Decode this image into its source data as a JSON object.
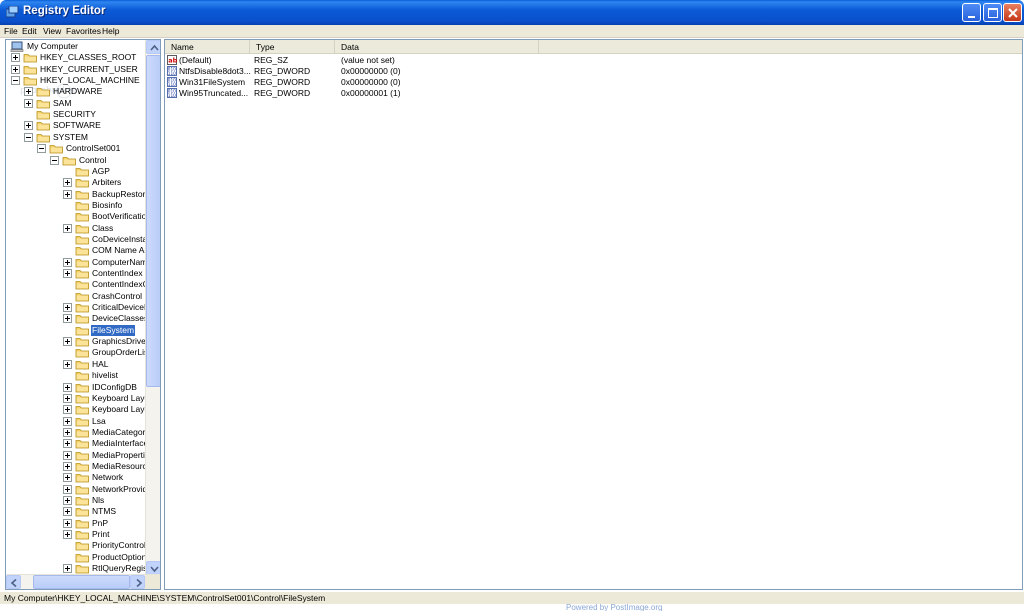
{
  "window": {
    "title": "Registry Editor"
  },
  "menu": [
    "File",
    "Edit",
    "View",
    "Favorites",
    "Help"
  ],
  "tree": [
    {
      "label": "My Computer",
      "indent": 0,
      "expander": "none",
      "icon": "computer"
    },
    {
      "label": "HKEY_CLASSES_ROOT",
      "indent": 1,
      "expander": "plus",
      "icon": "folder"
    },
    {
      "label": "HKEY_CURRENT_USER",
      "indent": 1,
      "expander": "plus",
      "icon": "folder"
    },
    {
      "label": "HKEY_LOCAL_MACHINE",
      "indent": 1,
      "expander": "minus",
      "icon": "folder"
    },
    {
      "label": "HARDWARE",
      "indent": 2,
      "expander": "plus",
      "icon": "folder"
    },
    {
      "label": "SAM",
      "indent": 2,
      "expander": "plus",
      "icon": "folder"
    },
    {
      "label": "SECURITY",
      "indent": 2,
      "expander": "none",
      "icon": "folder"
    },
    {
      "label": "SOFTWARE",
      "indent": 2,
      "expander": "plus",
      "icon": "folder"
    },
    {
      "label": "SYSTEM",
      "indent": 2,
      "expander": "minus",
      "icon": "folder"
    },
    {
      "label": "ControlSet001",
      "indent": 3,
      "expander": "minus",
      "icon": "folder"
    },
    {
      "label": "Control",
      "indent": 4,
      "expander": "minus",
      "icon": "folder-open"
    },
    {
      "label": "AGP",
      "indent": 5,
      "expander": "none",
      "icon": "folder"
    },
    {
      "label": "Arbiters",
      "indent": 5,
      "expander": "plus",
      "icon": "folder"
    },
    {
      "label": "BackupRestore",
      "indent": 5,
      "expander": "plus",
      "icon": "folder"
    },
    {
      "label": "Biosinfo",
      "indent": 5,
      "expander": "none",
      "icon": "folder"
    },
    {
      "label": "BootVerificationI",
      "indent": 5,
      "expander": "none",
      "icon": "folder"
    },
    {
      "label": "Class",
      "indent": 5,
      "expander": "plus",
      "icon": "folder"
    },
    {
      "label": "CoDeviceInstalle",
      "indent": 5,
      "expander": "none",
      "icon": "folder"
    },
    {
      "label": "COM Name Arbi",
      "indent": 5,
      "expander": "none",
      "icon": "folder"
    },
    {
      "label": "ComputerName",
      "indent": 5,
      "expander": "plus",
      "icon": "folder"
    },
    {
      "label": "ContentIndex",
      "indent": 5,
      "expander": "plus",
      "icon": "folder"
    },
    {
      "label": "ContentIndexCo",
      "indent": 5,
      "expander": "none",
      "icon": "folder"
    },
    {
      "label": "CrashControl",
      "indent": 5,
      "expander": "none",
      "icon": "folder"
    },
    {
      "label": "CriticalDeviceDa",
      "indent": 5,
      "expander": "plus",
      "icon": "folder"
    },
    {
      "label": "DeviceClasses",
      "indent": 5,
      "expander": "plus",
      "icon": "folder"
    },
    {
      "label": "FileSystem",
      "indent": 5,
      "expander": "none",
      "icon": "folder-open",
      "selected": true
    },
    {
      "label": "GraphicsDrivers",
      "indent": 5,
      "expander": "plus",
      "icon": "folder"
    },
    {
      "label": "GroupOrderList",
      "indent": 5,
      "expander": "none",
      "icon": "folder"
    },
    {
      "label": "HAL",
      "indent": 5,
      "expander": "plus",
      "icon": "folder"
    },
    {
      "label": "hivelist",
      "indent": 5,
      "expander": "none",
      "icon": "folder"
    },
    {
      "label": "IDConfigDB",
      "indent": 5,
      "expander": "plus",
      "icon": "folder"
    },
    {
      "label": "Keyboard Layou",
      "indent": 5,
      "expander": "plus",
      "icon": "folder"
    },
    {
      "label": "Keyboard Layou",
      "indent": 5,
      "expander": "plus",
      "icon": "folder"
    },
    {
      "label": "Lsa",
      "indent": 5,
      "expander": "plus",
      "icon": "folder"
    },
    {
      "label": "MediaCategories",
      "indent": 5,
      "expander": "plus",
      "icon": "folder"
    },
    {
      "label": "MediaInterfaces",
      "indent": 5,
      "expander": "plus",
      "icon": "folder"
    },
    {
      "label": "MediaProperties",
      "indent": 5,
      "expander": "plus",
      "icon": "folder"
    },
    {
      "label": "MediaResources",
      "indent": 5,
      "expander": "plus",
      "icon": "folder"
    },
    {
      "label": "Network",
      "indent": 5,
      "expander": "plus",
      "icon": "folder"
    },
    {
      "label": "NetworkProvide",
      "indent": 5,
      "expander": "plus",
      "icon": "folder"
    },
    {
      "label": "Nls",
      "indent": 5,
      "expander": "plus",
      "icon": "folder"
    },
    {
      "label": "NTMS",
      "indent": 5,
      "expander": "plus",
      "icon": "folder"
    },
    {
      "label": "PnP",
      "indent": 5,
      "expander": "plus",
      "icon": "folder"
    },
    {
      "label": "Print",
      "indent": 5,
      "expander": "plus",
      "icon": "folder"
    },
    {
      "label": "PriorityControl",
      "indent": 5,
      "expander": "none",
      "icon": "folder"
    },
    {
      "label": "ProductOptions",
      "indent": 5,
      "expander": "none",
      "icon": "folder"
    },
    {
      "label": "RtlQueryRegistr",
      "indent": 5,
      "expander": "plus",
      "icon": "folder"
    }
  ],
  "list": {
    "columns": [
      "Name",
      "Type",
      "Data"
    ],
    "rows": [
      {
        "name": "(Default)",
        "type": "REG_SZ",
        "data": "(value not set)",
        "icon": "string-value-icon"
      },
      {
        "name": "NtfsDisable8dot3...",
        "type": "REG_DWORD",
        "data": "0x00000000 (0)",
        "icon": "binary-value-icon"
      },
      {
        "name": "Win31FileSystem",
        "type": "REG_DWORD",
        "data": "0x00000000 (0)",
        "icon": "binary-value-icon"
      },
      {
        "name": "Win95Truncated...",
        "type": "REG_DWORD",
        "data": "0x00000001 (1)",
        "icon": "binary-value-icon"
      }
    ]
  },
  "status": "My Computer\\HKEY_LOCAL_MACHINE\\SYSTEM\\ControlSet001\\Control\\FileSystem",
  "footer_watermark": "Powered by PostImage.org",
  "colors": {
    "titlebar": "#0b5ad6",
    "selection": "#316ac5",
    "chrome": "#ece9d8",
    "folder": "#f7d774"
  }
}
